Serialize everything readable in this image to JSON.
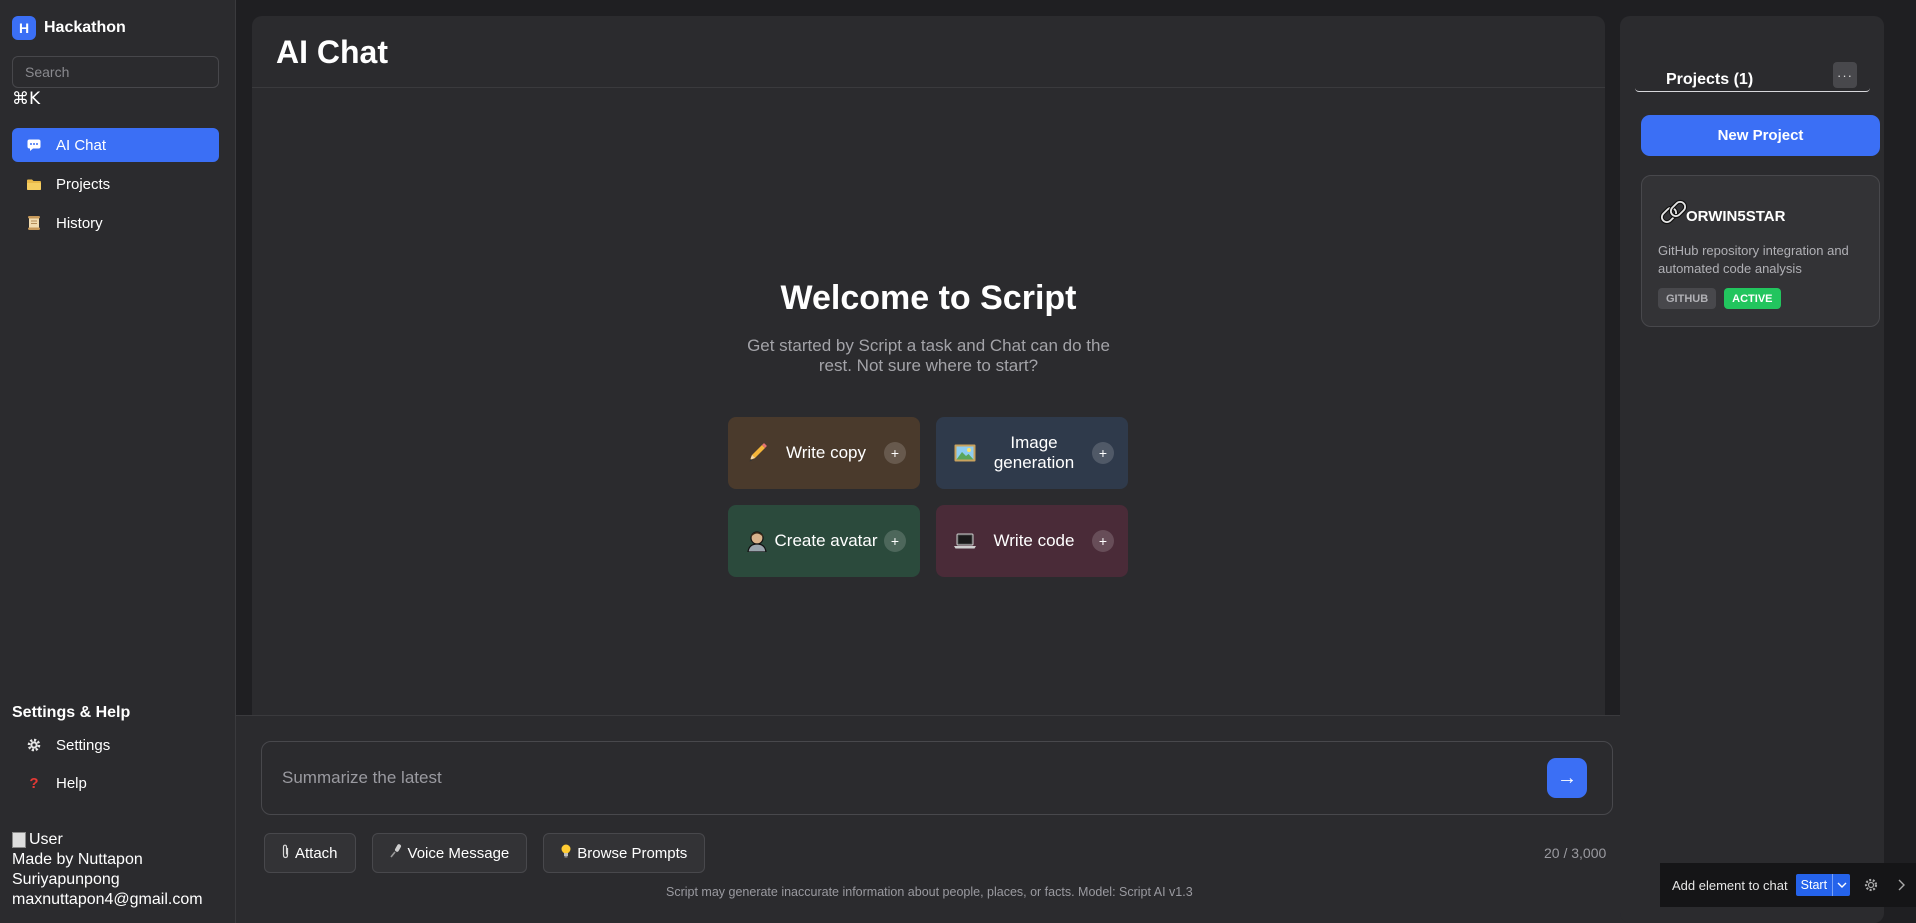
{
  "app": {
    "logo_letter": "H",
    "name": "Hackathon"
  },
  "sidebar": {
    "search_placeholder": "Search",
    "shortcut": "⌘K",
    "nav": [
      {
        "label": "AI Chat",
        "icon": "chat-icon",
        "active": true
      },
      {
        "label": "Projects",
        "icon": "folder-icon",
        "active": false
      },
      {
        "label": "History",
        "icon": "scroll-icon",
        "active": false
      }
    ],
    "settings_title": "Settings & Help",
    "settings_items": [
      {
        "label": "Settings",
        "icon": "gear-icon"
      },
      {
        "label": "Help",
        "icon": "question-icon"
      }
    ],
    "user": {
      "img_alt": "User",
      "made_by": "Made by Nuttapon",
      "surname": "Suriyapunpong",
      "email": "maxnuttapon4@gmail.com"
    }
  },
  "main": {
    "title": "AI Chat",
    "welcome_title": "Welcome to Script",
    "welcome_subtitle": "Get started by Script a task and Chat can do the rest. Not sure where to start?",
    "cards": [
      {
        "label": "Write copy",
        "icon": "pencil-icon",
        "color": "#4a3a2c"
      },
      {
        "label": "Image generation",
        "icon": "picture-icon",
        "color": "#2f3a4b"
      },
      {
        "label": "Create avatar",
        "icon": "avatar-icon",
        "color": "#2b4a3c"
      },
      {
        "label": "Write code",
        "icon": "laptop-icon",
        "color": "#4a2b38"
      }
    ],
    "card_plus": "+"
  },
  "composer": {
    "placeholder": "Summarize the latest",
    "send_symbol": "→",
    "tools": [
      {
        "label": "Attach",
        "icon": "paperclip-icon"
      },
      {
        "label": "Voice Message",
        "icon": "microphone-icon"
      },
      {
        "label": "Browse Prompts",
        "icon": "lightbulb-icon"
      }
    ],
    "counter": "20 / 3,000",
    "disclaimer": "Script may generate inaccurate information about people, places, or facts. Model: Script AI v1.3"
  },
  "projects_panel": {
    "title": "Projects (1)",
    "more_symbol": "···",
    "new_project_label": "New Project",
    "project": {
      "name": "ORWIN5STAR",
      "icon": "link-icon",
      "description": "GitHub repository integration and automated code analysis",
      "tags": [
        "GITHUB",
        "ACTIVE"
      ]
    }
  },
  "float_bar": {
    "label": "Add element to chat",
    "start_label": "Start"
  },
  "colors": {
    "accent": "#3b6ff5",
    "active_tag": "#22c55e",
    "panel": "#2b2b2e",
    "background": "#1f1f22"
  }
}
